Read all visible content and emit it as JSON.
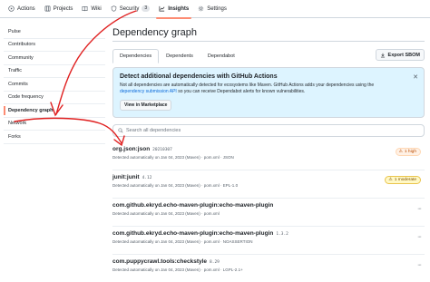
{
  "tabs": [
    {
      "label": "Actions",
      "icon": "play-icon"
    },
    {
      "label": "Projects",
      "icon": "table-icon"
    },
    {
      "label": "Wiki",
      "icon": "book-icon"
    },
    {
      "label": "Security",
      "icon": "shield-icon",
      "count": "3"
    },
    {
      "label": "Insights",
      "icon": "graph-icon",
      "active": true
    },
    {
      "label": "Settings",
      "icon": "gear-icon"
    }
  ],
  "sidebar": {
    "items": [
      {
        "label": "Pulse"
      },
      {
        "label": "Contributors"
      },
      {
        "label": "Community"
      },
      {
        "label": "Traffic"
      },
      {
        "label": "Commits"
      },
      {
        "label": "Code frequency"
      },
      {
        "label": "Dependency graph",
        "selected": true
      },
      {
        "label": "Network"
      },
      {
        "label": "Forks"
      }
    ]
  },
  "main": {
    "title": "Dependency graph",
    "subtabs": [
      "Dependencies",
      "Dependents",
      "Dependabot"
    ],
    "export_label": "Export SBOM",
    "banner": {
      "title": "Detect additional dependencies with GitHub Actions",
      "text_before": "Not all dependencies are automatically detected for ecosystems like Maven. GitHub Actions adds your dependencies using the ",
      "link": "dependency submission API",
      "text_after": " so you can receive Dependabot alerts for known vulnerabilities.",
      "button": "View in Marketplace"
    },
    "search_placeholder": "Search all dependencies",
    "dependencies": [
      {
        "name": "org.json:json",
        "version": "20210307",
        "meta": "Detected automatically on Jan 04, 2023 (Maven) · pom.xml · JSON",
        "severity": "1 high",
        "level": "high"
      },
      {
        "name": "junit:junit",
        "version": "4.12",
        "meta": "Detected automatically on Jan 04, 2023 (Maven) · pom.xml · EPL-1.0",
        "severity": "1 moderate",
        "level": "moderate"
      },
      {
        "name": "com.github.ekryd.echo-maven-plugin:echo-maven-plugin",
        "version": "",
        "meta": "Detected automatically on Jan 04, 2023 (Maven) · pom.xml",
        "severity": "",
        "level": ""
      },
      {
        "name": "com.github.ekryd.echo-maven-plugin:echo-maven-plugin",
        "version": "1.3.2",
        "meta": "Detected automatically on Jan 04, 2023 (Maven) · pom.xml · NOASSERTION",
        "severity": "",
        "level": ""
      },
      {
        "name": "com.puppycrawl.tools:checkstyle",
        "version": "8.29",
        "meta": "Detected automatically on Jan 04, 2023 (Maven) · pom.xml · LGPL-2.1+",
        "severity": "",
        "level": ""
      }
    ]
  },
  "colors": {
    "annotation": "#e02020",
    "accent": "#fd8c73",
    "link": "#0969da"
  }
}
